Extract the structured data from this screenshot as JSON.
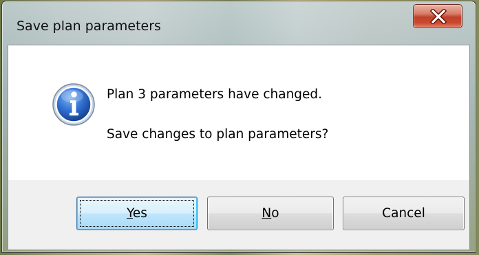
{
  "window": {
    "title": "Save plan parameters",
    "close_icon": "close-x-icon"
  },
  "message": {
    "icon": "information-icon",
    "line1": "Plan 3 parameters have changed.",
    "line2": "Save changes to plan parameters?"
  },
  "buttons": {
    "yes": {
      "mnemonic": "Y",
      "rest": "es"
    },
    "no": {
      "mnemonic": "N",
      "rest": "o"
    },
    "cancel": {
      "label": "Cancel"
    }
  },
  "colors": {
    "close_button": "#c94a30",
    "info_icon": "#1f5fc0",
    "default_button_border": "#3c7fb1"
  }
}
